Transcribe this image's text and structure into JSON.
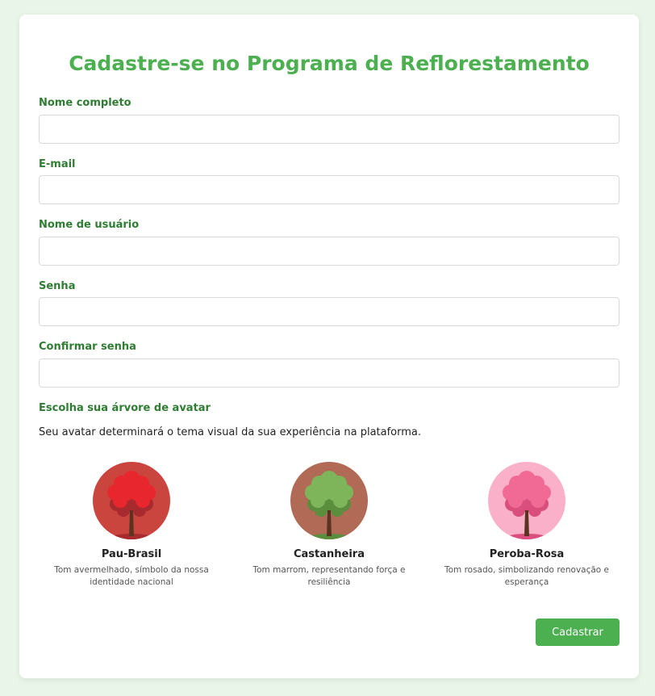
{
  "form": {
    "title": "Cadastre-se no Programa de Reflorestamento",
    "fields": [
      {
        "label": "Nome completo",
        "value": "",
        "placeholder": ""
      },
      {
        "label": "E-mail",
        "value": "",
        "placeholder": ""
      },
      {
        "label": "Nome de usuário",
        "value": "",
        "placeholder": ""
      },
      {
        "label": "Senha",
        "value": "",
        "placeholder": ""
      },
      {
        "label": "Confirmar senha",
        "value": "",
        "placeholder": ""
      }
    ],
    "avatar_section": {
      "label": "Escolha sua árvore de avatar",
      "description": "Seu avatar determinará o tema visual da sua experiência na plataforma.",
      "options": [
        {
          "name": "Pau-Brasil",
          "description": "Tom avermelhado, símbolo da nossa identidade nacional",
          "icon": "tree-icon",
          "bg_color": "#c9453e",
          "foliage_color": "#e8262d",
          "foliage_dark": "#a72a2e"
        },
        {
          "name": "Castanheira",
          "description": "Tom marrom, representando força e resiliência",
          "icon": "tree-icon",
          "bg_color": "#b06a55",
          "foliage_color": "#7fb55a",
          "foliage_dark": "#5b8e3c"
        },
        {
          "name": "Peroba-Rosa",
          "description": "Tom rosado, simbolizando renovação e esperança",
          "icon": "tree-icon",
          "bg_color": "#f9b0c8",
          "foliage_color": "#f06a95",
          "foliage_dark": "#d94e7c"
        }
      ]
    },
    "submit_label": "Cadastrar",
    "accent_color": "#4caf50"
  }
}
